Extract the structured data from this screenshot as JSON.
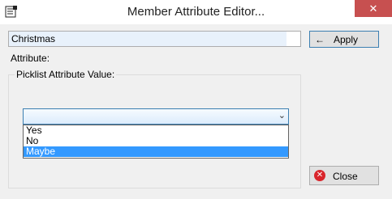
{
  "window": {
    "title": "Member Attribute Editor...",
    "close_glyph": "✕"
  },
  "name_field": {
    "value": "Christmas"
  },
  "apply_button": {
    "arrow": "←",
    "label": "Apply"
  },
  "attribute_label": "Attribute:",
  "picklist_group": {
    "label": "Picklist Attribute Value:"
  },
  "combo": {
    "selected_value": "",
    "chevron": "⌄"
  },
  "dropdown_options": [
    "Yes",
    "No",
    "Maybe"
  ],
  "dropdown_selected": "Maybe",
  "close_button": {
    "label": "Close",
    "icon_glyph": "✕"
  },
  "colors": {
    "selection": "#3399ff",
    "close_x": "#c75050",
    "accent": "#3c7fb1"
  }
}
